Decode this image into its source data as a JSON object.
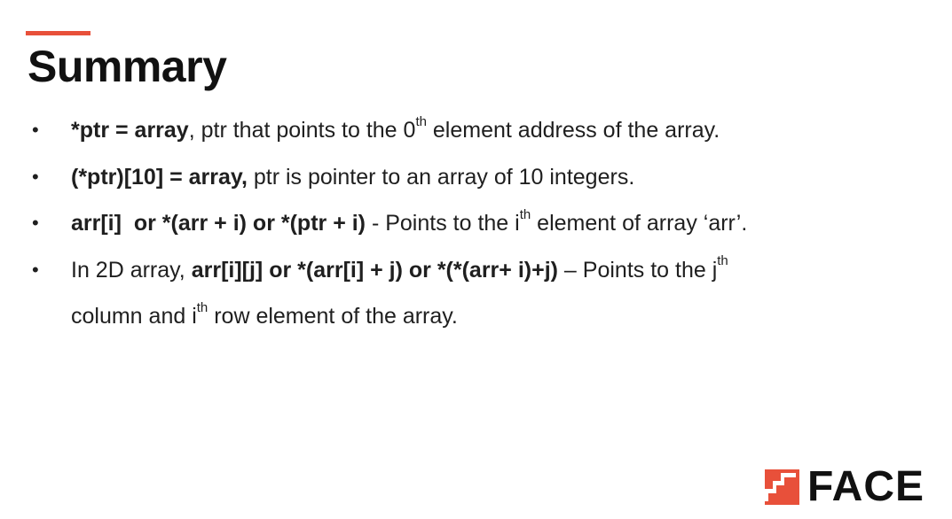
{
  "slide": {
    "title": "Summary",
    "accent_color": "#e8503a"
  },
  "bullets": [
    {
      "marker": "•",
      "b1_bold": "*ptr = array",
      "b1_text1": ", ptr that points to the 0",
      "b1_sup": "th",
      "b1_text2": " element address of the array."
    },
    {
      "marker": "•",
      "b2_bold": "(*ptr)[10] = array,",
      "b2_text": " ptr is pointer to an array of 10 integers."
    },
    {
      "marker": "•",
      "b3_bold": "arr[i]  or *(arr + i) or *(ptr + i)",
      "b3_text1": " - Points to the i",
      "b3_sup": "th",
      "b3_text2": " element of array ‘arr’."
    },
    {
      "marker": "•",
      "b4_text1": "In 2D array, ",
      "b4_bold": "arr[i][j] or *(arr[i] + j) or *(*(arr+ i)+j)",
      "b4_text2": " – Points to the j",
      "b4_sup1": "th",
      "b4_text3": "column and i",
      "b4_sup2": "th",
      "b4_text4": " row element of the array."
    }
  ],
  "logo": {
    "text": "FACE",
    "icon": "face-staircase-logo-icon"
  }
}
